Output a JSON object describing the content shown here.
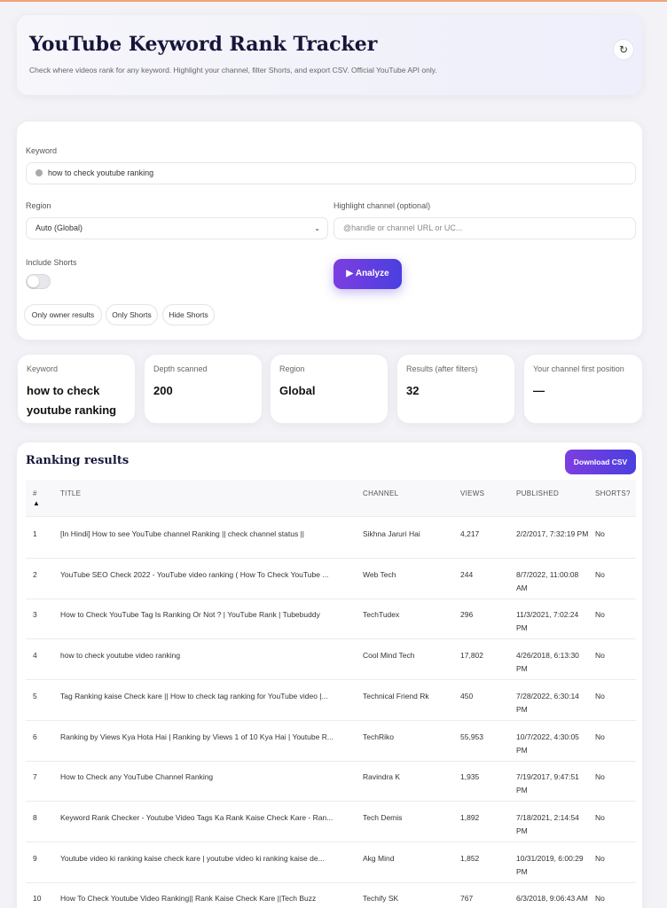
{
  "header": {
    "title": "YouTube Keyword Rank Tracker",
    "subtitle": "Check where videos rank for any keyword. Highlight your channel, filter Shorts, and export CSV. Official YouTube API only.",
    "refresh_icon": "refresh-icon"
  },
  "form": {
    "keyword_label": "Keyword",
    "keyword_value": "how to check youtube ranking",
    "region_label": "Region",
    "region_value": "Auto (Global)",
    "highlight_label": "Highlight channel (optional)",
    "highlight_placeholder": "@handle or channel URL or UC...",
    "shorts_label": "Include Shorts",
    "shorts_enabled": false,
    "filters": [
      "Only owner results",
      "Only Shorts",
      "Hide Shorts"
    ],
    "analyze_label": "Analyze"
  },
  "stats": [
    {
      "label": "Keyword",
      "value": "how to check youtube ranking"
    },
    {
      "label": "Depth scanned",
      "value": "200"
    },
    {
      "label": "Region",
      "value": "Global"
    },
    {
      "label": "Results (after filters)",
      "value": "32"
    },
    {
      "label": "Your channel first position",
      "value": "—"
    }
  ],
  "results": {
    "title": "Ranking results",
    "download_label": "Download CSV",
    "columns": [
      "#",
      "TITLE",
      "CHANNEL",
      "VIEWS",
      "PUBLISHED",
      "SHORTS?"
    ],
    "sort_arrow": "▲",
    "rows": [
      {
        "rank": "1",
        "title": "[In Hindi] How to see YouTube channel Ranking || check channel status ||",
        "channel": "Sikhna Jaruri Hai",
        "views": "4,217",
        "published": "2/2/2017, 7:32:19 PM",
        "shorts": "No"
      },
      {
        "rank": "2",
        "title": "YouTube SEO Check 2022 - YouTube video ranking ( How To Check YouTube ...",
        "channel": "Web Tech",
        "views": "244",
        "published": "8/7/2022, 11:00:08 AM",
        "shorts": "No"
      },
      {
        "rank": "3",
        "title": "How to Check YouTube Tag Is Ranking Or Not ? | YouTube Rank | Tubebuddy",
        "channel": "TechTudex",
        "views": "296",
        "published": "11/3/2021, 7:02:24 PM",
        "shorts": "No"
      },
      {
        "rank": "4",
        "title": "how to check youtube video ranking",
        "channel": "Cool Mind Tech",
        "views": "17,802",
        "published": "4/26/2018, 6:13:30 PM",
        "shorts": "No"
      },
      {
        "rank": "5",
        "title": "Tag Ranking kaise Check kare || How to check tag ranking for YouTube video |...",
        "channel": "Technical Friend Rk",
        "views": "450",
        "published": "7/28/2022, 6:30:14 PM",
        "shorts": "No"
      },
      {
        "rank": "6",
        "title": "Ranking by Views Kya Hota Hai | Ranking by Views 1 of 10 Kya Hai | Youtube R...",
        "channel": "TechRiko",
        "views": "55,953",
        "published": "10/7/2022, 4:30:05 PM",
        "shorts": "No"
      },
      {
        "rank": "7",
        "title": "How to Check any YouTube Channel Ranking",
        "channel": "Ravindra K",
        "views": "1,935",
        "published": "7/19/2017, 9:47:51 PM",
        "shorts": "No"
      },
      {
        "rank": "8",
        "title": "Keyword Rank Checker - Youtube Video Tags Ka Rank Kaise Check Kare - Ran...",
        "channel": "Tech Demis",
        "views": "1,892",
        "published": "7/18/2021, 2:14:54 PM",
        "shorts": "No"
      },
      {
        "rank": "9",
        "title": "Youtube video ki ranking kaise check kare | youtube video ki ranking kaise de...",
        "channel": "Akg Mind",
        "views": "1,852",
        "published": "10/31/2019, 6:00:29 PM",
        "shorts": "No"
      },
      {
        "rank": "10",
        "title": "How To Check Youtube Video Ranking|| Rank Kaise Check Kare ||Tech Buzz",
        "channel": "Techify SK",
        "views": "767",
        "published": "6/3/2018, 9:06:43 AM",
        "shorts": "No"
      }
    ]
  }
}
